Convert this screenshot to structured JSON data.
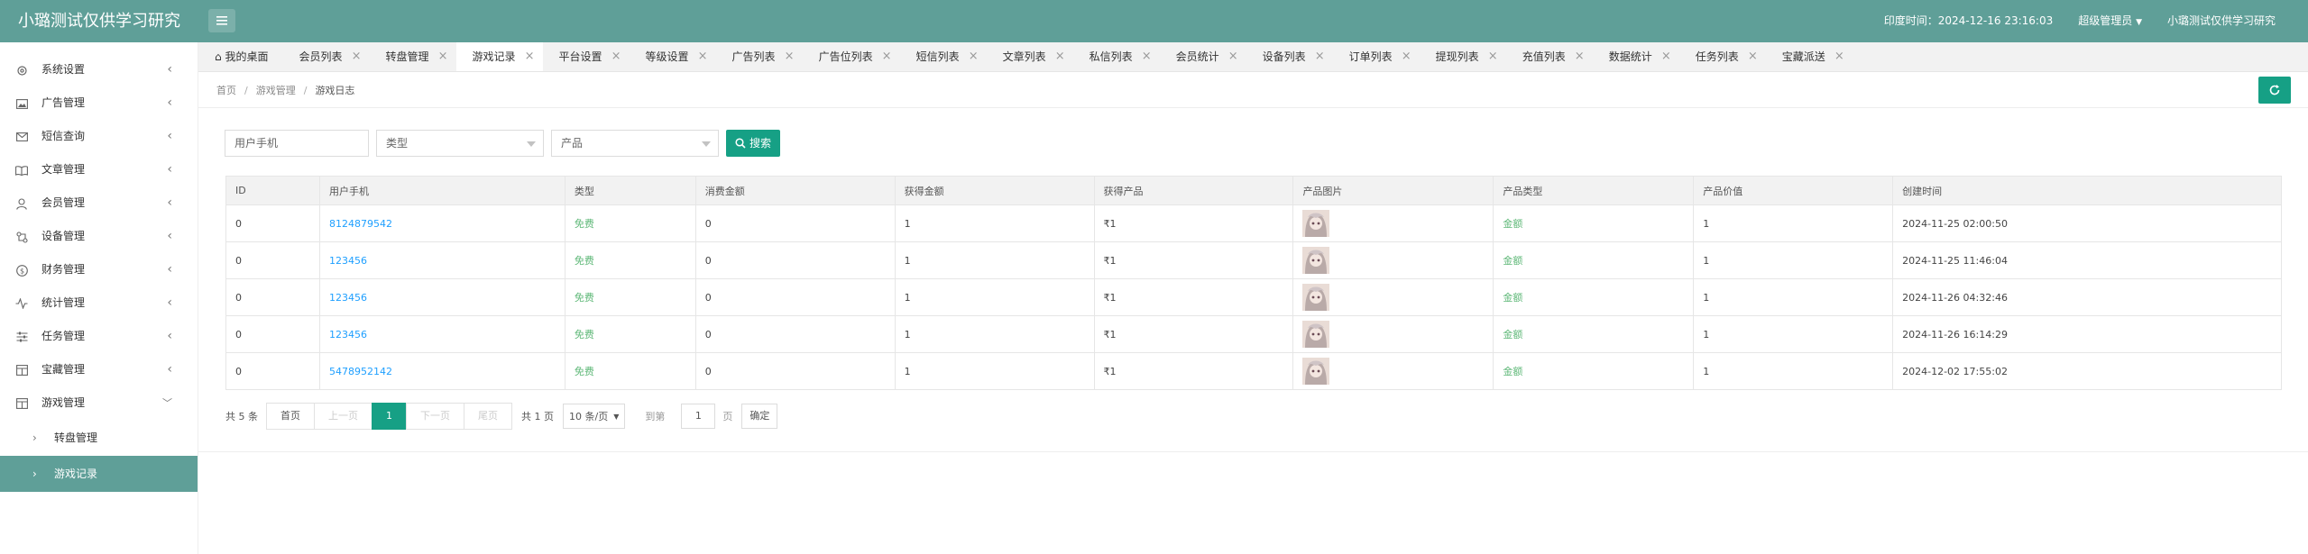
{
  "app": {
    "title": "小璐测试仅供学习研究"
  },
  "header": {
    "time_label": "印度时间：2024-12-16 23:16:03",
    "role_label": "超级管理员",
    "site_label": "小璐测试仅供学习研究"
  },
  "sidebar": {
    "items": [
      {
        "label": "系统设置",
        "icon": "gear-icon"
      },
      {
        "label": "广告管理",
        "icon": "image-icon"
      },
      {
        "label": "短信查询",
        "icon": "mail-icon"
      },
      {
        "label": "文章管理",
        "icon": "book-icon"
      },
      {
        "label": "会员管理",
        "icon": "user-icon"
      },
      {
        "label": "设备管理",
        "icon": "devices-icon"
      },
      {
        "label": "财务管理",
        "icon": "dollar-icon"
      },
      {
        "label": "统计管理",
        "icon": "pulse-icon"
      },
      {
        "label": "任务管理",
        "icon": "sliders-icon"
      },
      {
        "label": "宝藏管理",
        "icon": "grid-icon"
      },
      {
        "label": "游戏管理",
        "icon": "grid-icon"
      }
    ],
    "subitems": [
      {
        "label": "转盘管理"
      },
      {
        "label": "游戏记录"
      }
    ]
  },
  "tabs": [
    "我的桌面",
    "会员列表",
    "转盘管理",
    "游戏记录",
    "平台设置",
    "等级设置",
    "广告列表",
    "广告位列表",
    "短信列表",
    "文章列表",
    "私信列表",
    "会员统计",
    "设备列表",
    "订单列表",
    "提现列表",
    "充值列表",
    "数据统计",
    "任务列表",
    "宝藏派送"
  ],
  "breadcrumb": {
    "home": "首页",
    "section": "游戏管理",
    "current": "游戏日志"
  },
  "search": {
    "phone_placeholder": "用户手机",
    "type_placeholder": "类型",
    "product_placeholder": "产品",
    "search_label": "搜索"
  },
  "table": {
    "columns": [
      "ID",
      "用户手机",
      "类型",
      "消费金额",
      "获得金额",
      "获得产品",
      "产品图片",
      "产品类型",
      "产品价值",
      "创建时间"
    ],
    "rows": [
      {
        "id": "0",
        "phone": "8124879542",
        "type": "免费",
        "spend": "0",
        "gain": "1",
        "product": "₹1",
        "ptype": "金额",
        "value": "1",
        "created": "2024-11-25 02:00:50"
      },
      {
        "id": "0",
        "phone": "123456",
        "type": "免费",
        "spend": "0",
        "gain": "1",
        "product": "₹1",
        "ptype": "金额",
        "value": "1",
        "created": "2024-11-25 11:46:04"
      },
      {
        "id": "0",
        "phone": "123456",
        "type": "免费",
        "spend": "0",
        "gain": "1",
        "product": "₹1",
        "ptype": "金额",
        "value": "1",
        "created": "2024-11-26 04:32:46"
      },
      {
        "id": "0",
        "phone": "123456",
        "type": "免费",
        "spend": "0",
        "gain": "1",
        "product": "₹1",
        "ptype": "金额",
        "value": "1",
        "created": "2024-11-26 16:14:29"
      },
      {
        "id": "0",
        "phone": "5478952142",
        "type": "免费",
        "spend": "0",
        "gain": "1",
        "product": "₹1",
        "ptype": "金额",
        "value": "1",
        "created": "2024-12-02 17:55:02"
      }
    ]
  },
  "pager": {
    "total": "共 5 条",
    "first": "首页",
    "prev": "上一页",
    "current": "1",
    "next": "下一页",
    "last": "尾页",
    "pages": "共 1 页",
    "page_size": "10 条/页",
    "goto": "到第",
    "goto_value": "1",
    "page_unit": "页",
    "confirm": "确定"
  },
  "colors": {
    "header": "#5f9f98",
    "accent": "#16a085",
    "link": "#1e9fff",
    "green": "#5fb878"
  }
}
